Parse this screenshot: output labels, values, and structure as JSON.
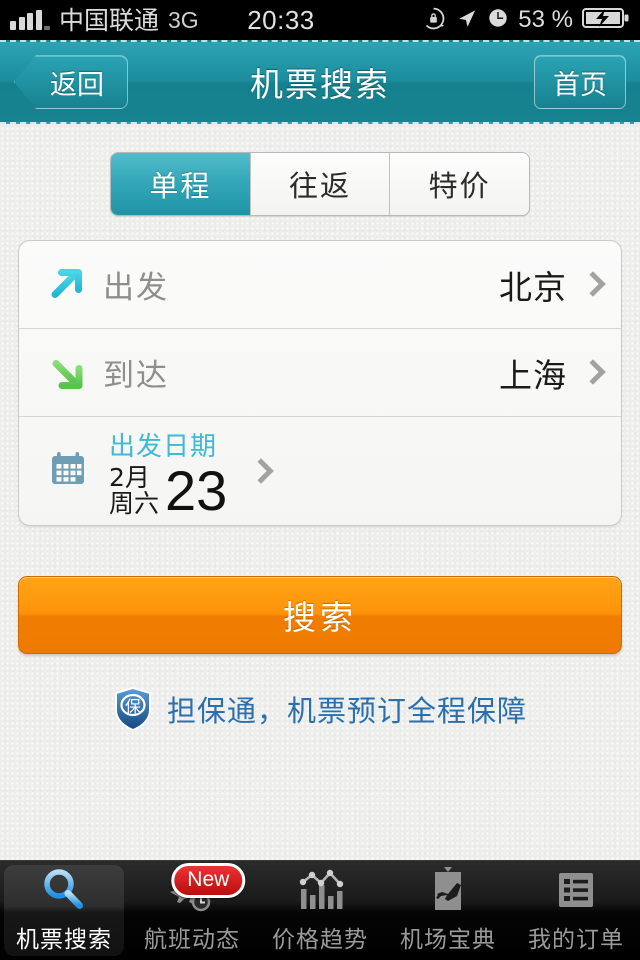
{
  "statusbar": {
    "carrier": "中国联通",
    "network": "3G",
    "time": "20:33",
    "battery_percent": "53 %",
    "icons": [
      "signal-bars-icon",
      "rotation-lock-icon",
      "location-arrow-icon",
      "alarm-clock-icon",
      "battery-charging-icon"
    ]
  },
  "navbar": {
    "back_label": "返回",
    "title": "机票搜索",
    "home_label": "首页",
    "accent_color": "#1d8d9d"
  },
  "segmented": {
    "options": [
      {
        "label": "单程",
        "selected": true
      },
      {
        "label": "往返",
        "selected": false
      },
      {
        "label": "特价",
        "selected": false
      }
    ],
    "active_color": "#34a8b9"
  },
  "form": {
    "departure": {
      "icon": "arrow-up-right-icon",
      "icon_color": "#35c6df",
      "label": "出发",
      "value": "北京"
    },
    "arrival": {
      "icon": "arrow-down-right-icon",
      "icon_color": "#6dcc62",
      "label": "到达",
      "value": "上海"
    },
    "date": {
      "icon": "calendar-icon",
      "icon_color": "#5b8fa8",
      "title": "出发日期",
      "title_color": "#3fb9d4",
      "month": "2月",
      "weekday": "周六",
      "day": "23"
    }
  },
  "search_button": {
    "label": "搜索",
    "color": "#f78c06"
  },
  "guarantee": {
    "badge_icon": "shield-badge-icon",
    "badge_char": "保",
    "text": "担保通，机票预订全程保障",
    "text_color": "#2a6fae"
  },
  "tabbar": {
    "items": [
      {
        "label": "机票搜索",
        "icon": "magnifier-icon",
        "active": true,
        "badge": ""
      },
      {
        "label": "航班动态",
        "icon": "plane-clock-icon",
        "active": false,
        "badge": "New"
      },
      {
        "label": "价格趋势",
        "icon": "bar-chart-icon",
        "active": false,
        "badge": ""
      },
      {
        "label": "机场宝典",
        "icon": "airport-book-icon",
        "active": false,
        "badge": ""
      },
      {
        "label": "我的订单",
        "icon": "order-list-icon",
        "active": false,
        "badge": ""
      }
    ]
  }
}
